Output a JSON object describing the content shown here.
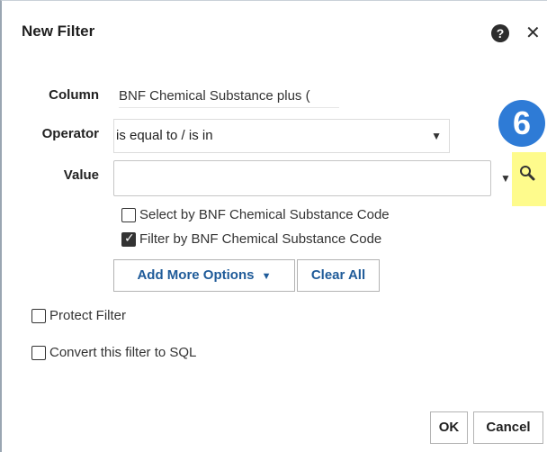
{
  "dialog": {
    "title": "New Filter",
    "help_icon": "help-icon",
    "close_icon": "close-icon"
  },
  "fields": {
    "column_label": "Column",
    "column_value": "BNF Chemical Substance plus (",
    "operator_label": "Operator",
    "operator_value": "is equal to / is in",
    "value_label": "Value",
    "value_value": ""
  },
  "badge": {
    "number": "6",
    "color": "#2e7bd6"
  },
  "checkboxes": {
    "select_by_code": {
      "label": "Select by BNF Chemical Substance Code",
      "checked": false
    },
    "filter_by_code": {
      "label": "Filter by BNF Chemical Substance Code",
      "checked": true
    },
    "protect_filter": {
      "label": "Protect Filter",
      "checked": false
    },
    "convert_sql": {
      "label": "Convert this filter to SQL",
      "checked": false
    }
  },
  "buttons": {
    "add_more_options": "Add More Options",
    "clear_all": "Clear All",
    "ok": "OK",
    "cancel": "Cancel"
  },
  "colors": {
    "highlight": "#fefb8c",
    "link_blue": "#1f5b99"
  }
}
